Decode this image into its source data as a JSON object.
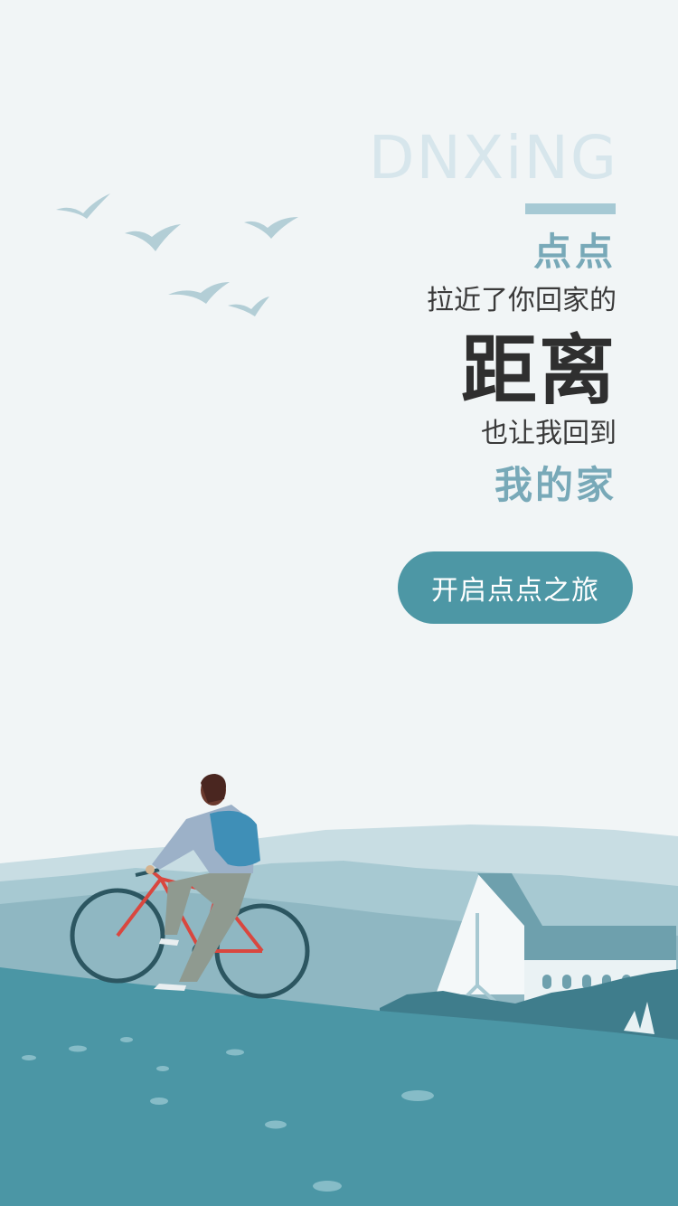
{
  "brand": {
    "name": "DNXiNG"
  },
  "headline": {
    "line1": "点点",
    "line2": "拉近了你回家的",
    "line3": "距离",
    "line4": "也让我回到",
    "line5": "我的家"
  },
  "cta": {
    "label": "开启点点之旅"
  },
  "colors": {
    "background": "#f1f5f6",
    "accent": "#78a9b8",
    "button": "#4d97a5",
    "brand_text": "#d7e6ec"
  },
  "illustration": {
    "subject": "cyclist-riding-bicycle",
    "elements": [
      "birds",
      "hills",
      "house",
      "bicycle",
      "rider"
    ]
  }
}
